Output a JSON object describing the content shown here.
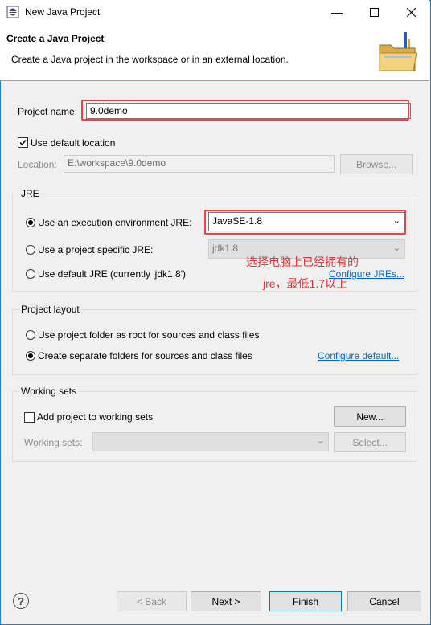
{
  "window": {
    "title": "New Java Project"
  },
  "banner": {
    "title": "Create a Java Project",
    "description": "Create a Java project in the workspace or in an external location."
  },
  "project": {
    "name_label": "Project name:",
    "name_value": "9.0demo"
  },
  "location": {
    "use_default_label": "Use default location",
    "use_default_checked": true,
    "location_label": "Location:",
    "location_value": "E:\\workspace\\9.0demo",
    "browse_label": "Browse..."
  },
  "jre": {
    "group_title": "JRE",
    "exec_env_label": "Use an execution environment JRE:",
    "exec_env_value": "JavaSE-1.8",
    "specific_label": "Use a project specific JRE:",
    "specific_value": "jdk1.8",
    "default_label": "Use default JRE (currently 'jdk1.8')",
    "configure_label": "Configure JREs...",
    "selected": "exec_env"
  },
  "annotation": {
    "line1": "选择电脑上已经拥有的",
    "line2": "jre，最低1.7以上",
    "color": "#e03636"
  },
  "layout": {
    "group_title": "Project layout",
    "single_root_label": "Use project folder as root for sources and class files",
    "separate_label": "Create separate folders for sources and class files",
    "configure_default_label": "Configure default...",
    "selected": "separate"
  },
  "working_sets": {
    "group_title": "Working sets",
    "add_label": "Add project to working sets",
    "add_checked": false,
    "new_label": "New...",
    "sets_label": "Working sets:",
    "select_label": "Select..."
  },
  "footer": {
    "back_label": "< Back",
    "next_label": "Next >",
    "finish_label": "Finish",
    "cancel_label": "Cancel"
  },
  "icons": {
    "title": "eclipse-icon",
    "banner": "folder-icon",
    "help": "help-icon",
    "minimize": "minimize-icon",
    "maximize": "maximize-icon",
    "close": "close-icon"
  }
}
